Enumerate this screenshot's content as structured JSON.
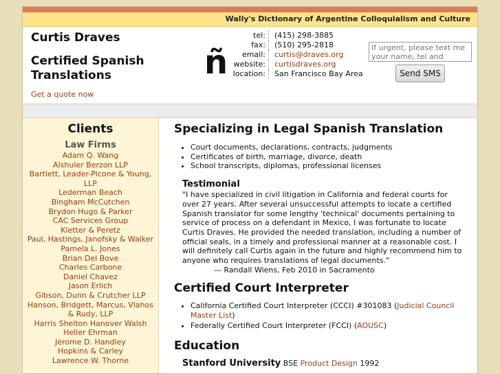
{
  "site": {
    "tagline": "Wally's Dictionary of Argentine Colloquialism and Culture",
    "name": "Curtis Draves",
    "subtitle": "Certified Spanish Translations",
    "quote_link": "Get a quote now",
    "logo_char": "ñ"
  },
  "contact": {
    "rows": [
      {
        "label": "tel:",
        "value": "(415) 298-3885"
      },
      {
        "label": "fax:",
        "value": "(510) 295-2818"
      },
      {
        "label": "email:",
        "value": "curtis@draves.org"
      },
      {
        "label": "website:",
        "value": "curtisdraves.org"
      },
      {
        "label": "location:",
        "value": "San Francisco Bay Area"
      }
    ]
  },
  "sms": {
    "placeholder": "If urgent, please text me your name, tel and email.",
    "button": "Send SMS"
  },
  "sidebar": {
    "title": "Clients",
    "subtitle": "Law Firms",
    "clients": [
      "Adam Q. Wang",
      "Alshuler Berzon LLP",
      "Bartlett, Leader-Picone & Young, LLP",
      "Lederman Beach",
      "Bingham McCutchen",
      "Brydon Hugo & Parker",
      "CAC Services Group",
      "Kletter & Peretz",
      "Paul, Hastings, Janofsky & Walker",
      "Pamela L. Jones",
      "Brian Del Bove",
      "Charles Carbone",
      "Daniel Chavez",
      "Jason Erlich",
      "Gibson, Dunn & Crutcher LLP",
      "Hanson, Bridgett, Marcus, Vlahos & Rudy, LLP",
      "Harris Shelton Hanover Walsh",
      "Heller Ehrman",
      "Jerome D. Handley",
      "Hopkins & Carley",
      "Lawrence W. Thorne"
    ]
  },
  "main": {
    "heading1": "Specializing in Legal Spanish Translation",
    "services": [
      "Court documents, declarations, contracts, judgments",
      "Certificates of birth, marriage, divorce, death",
      "School transcripts, diplomas, professional licenses"
    ],
    "testimonial_heading": "Testimonial",
    "testimonial": "\"I have specialized in civil litigation in California and federal courts for over 27 years. After several unsuccessful attempts to locate a certified Spanish translator for some lengthy 'technical' documents pertaining to service of process on a defendant in Mexico, I was fortunate to locate Curtis Draves. He provided the needed translation, including a number of official seals, in a timely and professional manner at a reasonable cost. I will definitely call Curtis again in the future and highly recommend him to anyone who requires translations of legal documents.\"",
    "testimonial_attrib": "— Randall Wiens, Feb 2010 in Sacramento",
    "heading2": "Certified Court Interpreter",
    "interp1_text": "California Certified Court Interpreter (CCCI) #301083 (",
    "interp1_link": "Judicial Council Master List",
    "interp1_end": ")",
    "interp2_text": "Federally Certified Court Interpreter (FCCI) (",
    "interp2_link": "AOUSC",
    "interp2_end": ")",
    "heading3": "Education",
    "edu_school": "Stanford University",
    "edu_degree": "BSE",
    "edu_field": "Product Design",
    "edu_year": "1992"
  }
}
